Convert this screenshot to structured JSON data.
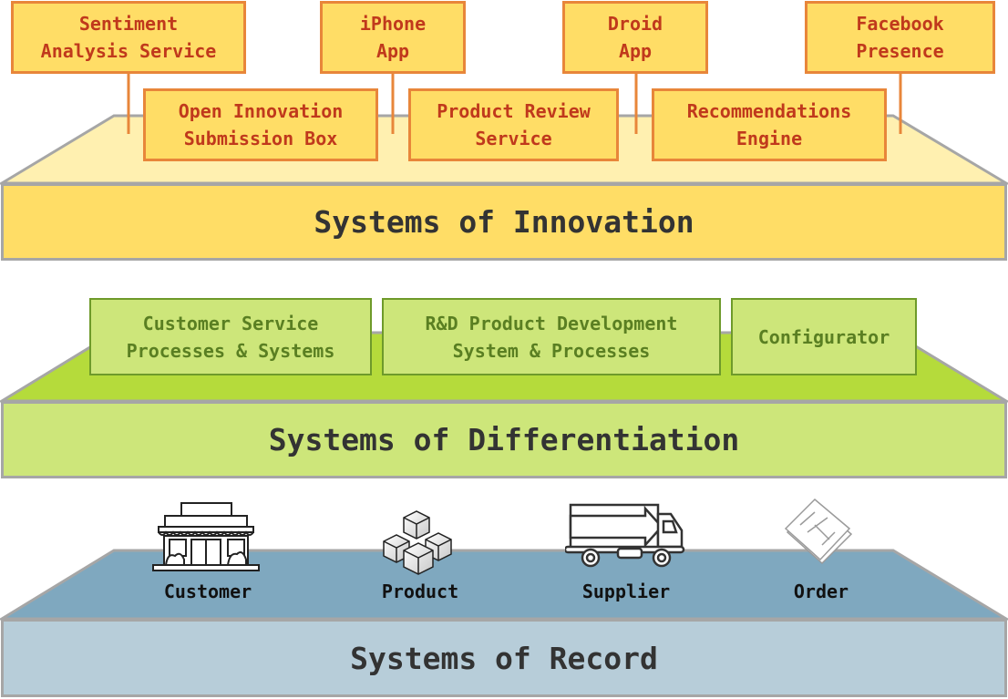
{
  "innovation": {
    "title": "Systems of Innovation",
    "boxes_top": [
      {
        "label": "Sentiment\nAnalysis Service"
      },
      {
        "label": "iPhone\nApp"
      },
      {
        "label": "Droid\nApp"
      },
      {
        "label": "Facebook\nPresence"
      }
    ],
    "boxes_bottom": [
      {
        "label": "Open Innovation\nSubmission Box"
      },
      {
        "label": "Product Review\nService"
      },
      {
        "label": "Recommendations\nEngine"
      }
    ]
  },
  "differentiation": {
    "title": "Systems of Differentiation",
    "boxes": [
      {
        "label": "Customer Service\nProcesses & Systems"
      },
      {
        "label": "R&D Product Development\nSystem & Processes"
      },
      {
        "label": "Configurator"
      }
    ]
  },
  "record": {
    "title": "Systems of Record",
    "entities": [
      {
        "label": "Customer",
        "icon": "storefront-icon"
      },
      {
        "label": "Product",
        "icon": "boxes-icon"
      },
      {
        "label": "Supplier",
        "icon": "truck-icon"
      },
      {
        "label": "Order",
        "icon": "documents-icon"
      }
    ]
  },
  "colors": {
    "innovation_top": "#fff0b0",
    "innovation_front": "#ffdd66",
    "innovation_box_border": "#e8863a",
    "innovation_text": "#c0391c",
    "differentiation_top": "#b5db3b",
    "differentiation_front": "#cde67a",
    "record_top": "#7fa8bf",
    "record_front": "#b7cdd9",
    "edge": "#a6a6a6"
  }
}
